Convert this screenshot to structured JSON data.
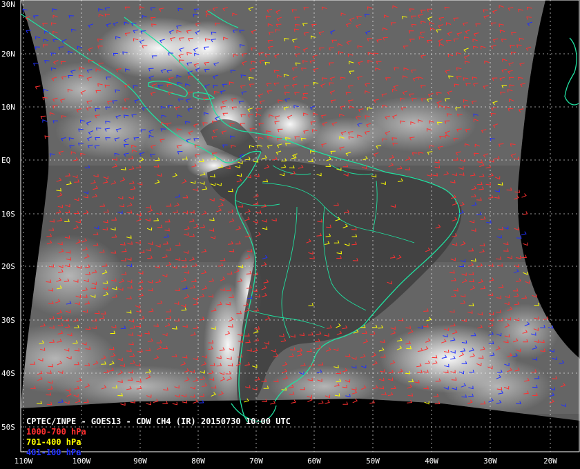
{
  "title": "CPTEC/INPE - GOES13 - CDW CH4 (IR) 20150730 10:00 UTC",
  "legend": [
    {
      "label": "1000-700 hPa",
      "color": "#ff3030"
    },
    {
      "label": "701-400 hPa",
      "color": "#ffff00"
    },
    {
      "label": "401-100 hPa",
      "color": "#2030ff"
    }
  ],
  "lat_labels": [
    "30N",
    "20N",
    "10N",
    "EQ",
    "10S",
    "20S",
    "30S",
    "40S",
    "50S"
  ],
  "lon_labels": [
    "110W",
    "100W",
    "90W",
    "80W",
    "70W",
    "60W",
    "50W",
    "40W",
    "30W",
    "20W"
  ],
  "colors": {
    "coastline": "#20e0a0",
    "grid": "#ffffff",
    "background": "#000000"
  }
}
